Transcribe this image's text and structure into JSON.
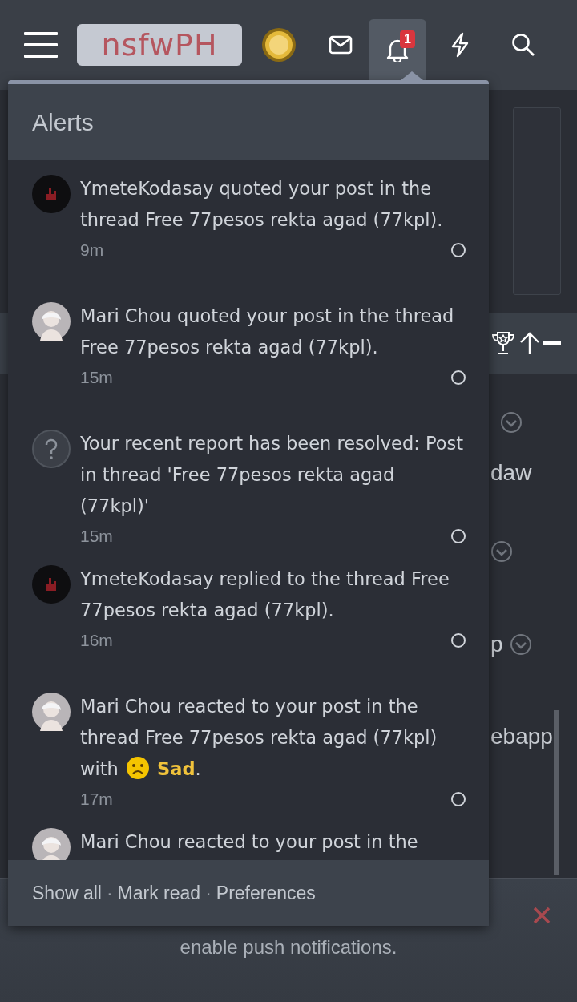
{
  "header": {
    "logo": "nsfwPH",
    "alerts_badge": "1"
  },
  "popup": {
    "title": "Alerts",
    "alerts": [
      {
        "kind": "dark",
        "text": "YmeteKodasay quoted your post in the thread Free 77pesos rekta agad (77kpl).",
        "time": "9m"
      },
      {
        "kind": "figure",
        "text": "Mari Chou quoted your post in the thread Free 77pesos rekta agad (77kpl).",
        "time": "15m"
      },
      {
        "kind": "unknown",
        "text": "Your recent report has been resolved: Post in thread 'Free 77pesos rekta agad (77kpl)'",
        "time": "15m"
      },
      {
        "kind": "dark",
        "text": "YmeteKodasay replied to the thread Free 77pesos rekta agad (77kpl).",
        "time": "16m"
      },
      {
        "kind": "figure",
        "text": "Mari Chou reacted to your post in the thread Free 77pesos rekta agad (77kpl) with",
        "reaction": "Sad",
        "end": ".",
        "time": "17m"
      },
      {
        "kind": "figure",
        "text": "Mari Chou reacted to your post in the"
      }
    ],
    "footer_links": [
      "Show all",
      "Mark read",
      "Preferences"
    ],
    "separator": "·"
  },
  "background": {
    "fragments": [
      "daw",
      "p",
      "ebapp"
    ],
    "notice": "enable push notifications."
  }
}
